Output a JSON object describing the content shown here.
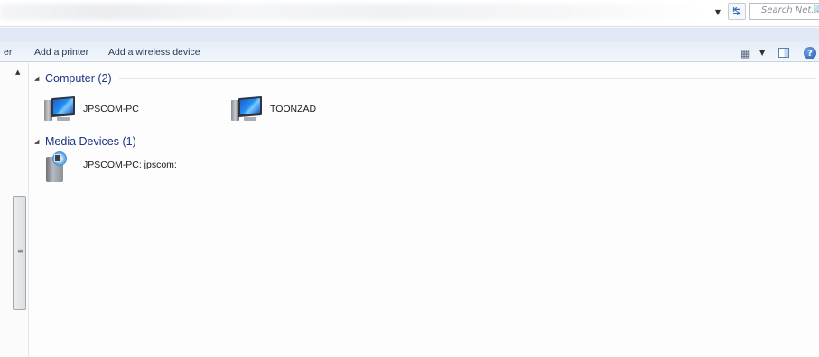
{
  "address_bar": {
    "search_placeholder": "Search Net...",
    "dropdown_glyph": "▼",
    "refresh_glyph": "↹"
  },
  "command_bar": {
    "partial_left_label": "er",
    "add_printer": "Add a printer",
    "add_wireless": "Add a wireless device",
    "views_glyph": "▦",
    "views_dropdown_glyph": "▼",
    "help_glyph": "?"
  },
  "nav_scroll": {
    "up_glyph": "▲",
    "grip_glyph": "≡"
  },
  "groups": [
    {
      "title": "Computer (2)",
      "caret": "◢",
      "items": [
        {
          "label": "JPSCOM-PC",
          "icon": "computer-icon"
        },
        {
          "label": "TOONZAD",
          "icon": "computer-icon"
        }
      ]
    },
    {
      "title": "Media Devices (1)",
      "caret": "◢",
      "items": [
        {
          "label": "JPSCOM-PC: jpscom:",
          "icon": "media-device-icon"
        }
      ]
    }
  ],
  "colors": {
    "group_title": "#1e3287",
    "command_text": "#1e3959",
    "toolbar_bg": "#e4ecf7"
  }
}
